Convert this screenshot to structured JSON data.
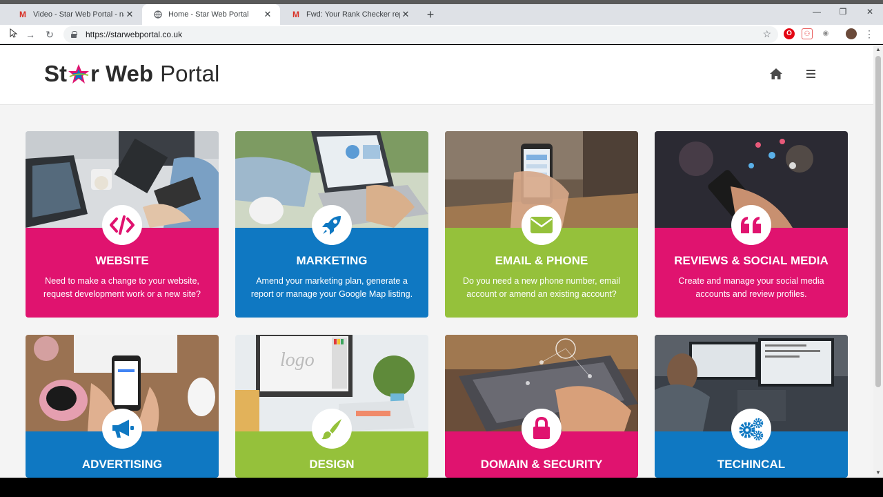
{
  "browser": {
    "tabs": [
      {
        "title": "Video - Star Web Portal - natash",
        "favicon": "gmail-icon",
        "active": false
      },
      {
        "title": "Home - Star Web Portal",
        "favicon": "globe-icon",
        "active": true
      },
      {
        "title": "Fwd: Your Rank Checker report 'T",
        "favicon": "gmail-icon",
        "active": false
      }
    ],
    "url": "https://starwebportal.co.uk"
  },
  "site": {
    "logo_bold_left": "St",
    "logo_bold_right": "r Web",
    "logo_light": "Portal",
    "header_icons": [
      "home-icon",
      "menu-icon"
    ]
  },
  "cards": [
    {
      "title": "WEBSITE",
      "desc": "Need to make a change to your website, request development work or a new site?",
      "color": "#e0136f",
      "icon": "code-icon"
    },
    {
      "title": "MARKETING",
      "desc": "Amend your marketing plan, generate a report or manage your Google Map listing.",
      "color": "#0f78c2",
      "icon": "rocket-icon"
    },
    {
      "title": "EMAIL & PHONE",
      "desc": "Do you need a new phone number, email account or amend an existing account?",
      "color": "#95c13b",
      "icon": "envelope-icon"
    },
    {
      "title": "REVIEWS & SOCIAL MEDIA",
      "desc": "Create and manage your social media accounts and review profiles.",
      "color": "#e0136f",
      "icon": "quote-icon"
    },
    {
      "title": "ADVERTISING",
      "desc": "",
      "color": "#0f78c2",
      "icon": "megaphone-icon"
    },
    {
      "title": "DESIGN",
      "desc": "",
      "color": "#95c13b",
      "icon": "paintbrush-icon"
    },
    {
      "title": "DOMAIN & SECURITY",
      "desc": "",
      "color": "#e0136f",
      "icon": "lock-icon"
    },
    {
      "title": "TECHINCAL",
      "desc": "",
      "color": "#0f78c2",
      "icon": "gears-icon"
    }
  ]
}
